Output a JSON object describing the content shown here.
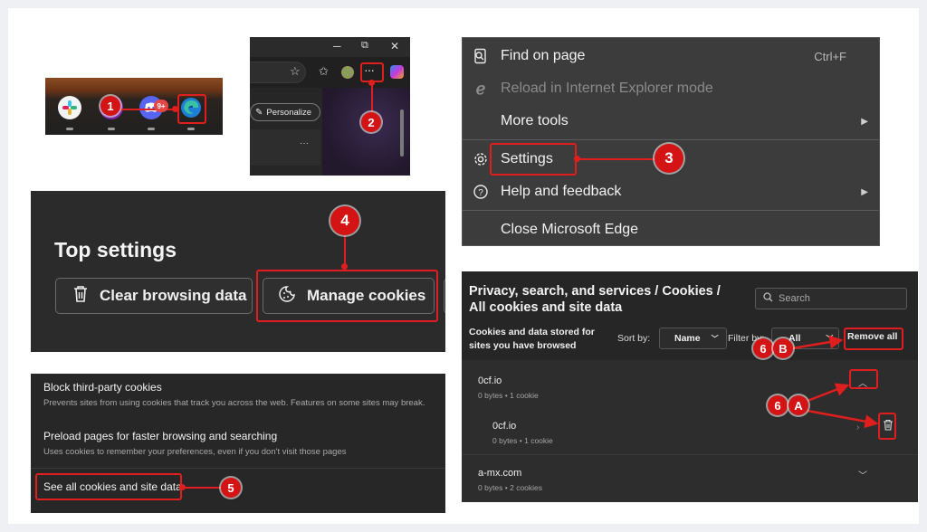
{
  "taskbar": {
    "badge": "1",
    "apps": [
      "slack-icon",
      "purple-app-icon",
      "discord-icon",
      "edge-icon"
    ],
    "notification_badge": "9+"
  },
  "browser_corner": {
    "window_controls": [
      "─",
      "⧉",
      "✕"
    ],
    "personalize_label": "Personalize",
    "more_label": "···",
    "badge": "2"
  },
  "context_menu": {
    "items": [
      {
        "label": "Find on page",
        "shortcut": "Ctrl+F"
      },
      {
        "label": "Reload in Internet Explorer mode",
        "disabled": true
      },
      {
        "label": "More tools",
        "submenu": true
      },
      {
        "label": "Settings"
      },
      {
        "label": "Help and feedback",
        "submenu": true
      },
      {
        "label": "Close Microsoft Edge"
      }
    ],
    "badge": "3"
  },
  "top_settings": {
    "heading": "Top settings",
    "clear_label": "Clear browsing data",
    "cookies_label": "Manage cookies",
    "badge": "4"
  },
  "cookie_settings": {
    "block_title": "Block third-party cookies",
    "block_desc": "Prevents sites from using cookies that track you across the web. Features on some sites may break.",
    "preload_title": "Preload pages for faster browsing and searching",
    "preload_desc": "Uses cookies to remember your preferences, even if you don't visit those pages",
    "see_all_label": "See all cookies and site data",
    "badge": "5"
  },
  "cookies_page": {
    "breadcrumb_line1": "Privacy, search, and services / Cookies /",
    "breadcrumb_line2": "All cookies and site data",
    "search_placeholder": "Search",
    "stored_line1": "Cookies and data stored for",
    "stored_line2": "sites you have browsed",
    "sort_label": "Sort by:",
    "sort_value": "Name",
    "filter_label": "Filter by:",
    "filter_value": "All",
    "remove_all_label": "Remove all",
    "sites": [
      {
        "name": "0cf.io",
        "info": "0 bytes • 1 cookie"
      },
      {
        "name": "0cf.io",
        "info": "0 bytes • 1 cookie"
      },
      {
        "name": "a-mx.com",
        "info": "0 bytes • 2 cookies"
      }
    ],
    "badge_b_num": "6",
    "badge_b_letter": "B",
    "badge_a_num": "6",
    "badge_a_letter": "A"
  },
  "colors": {
    "accent": "#e01e1e",
    "panel_dark": "#2b2b2b",
    "menu_bg": "#3c3c3c"
  }
}
